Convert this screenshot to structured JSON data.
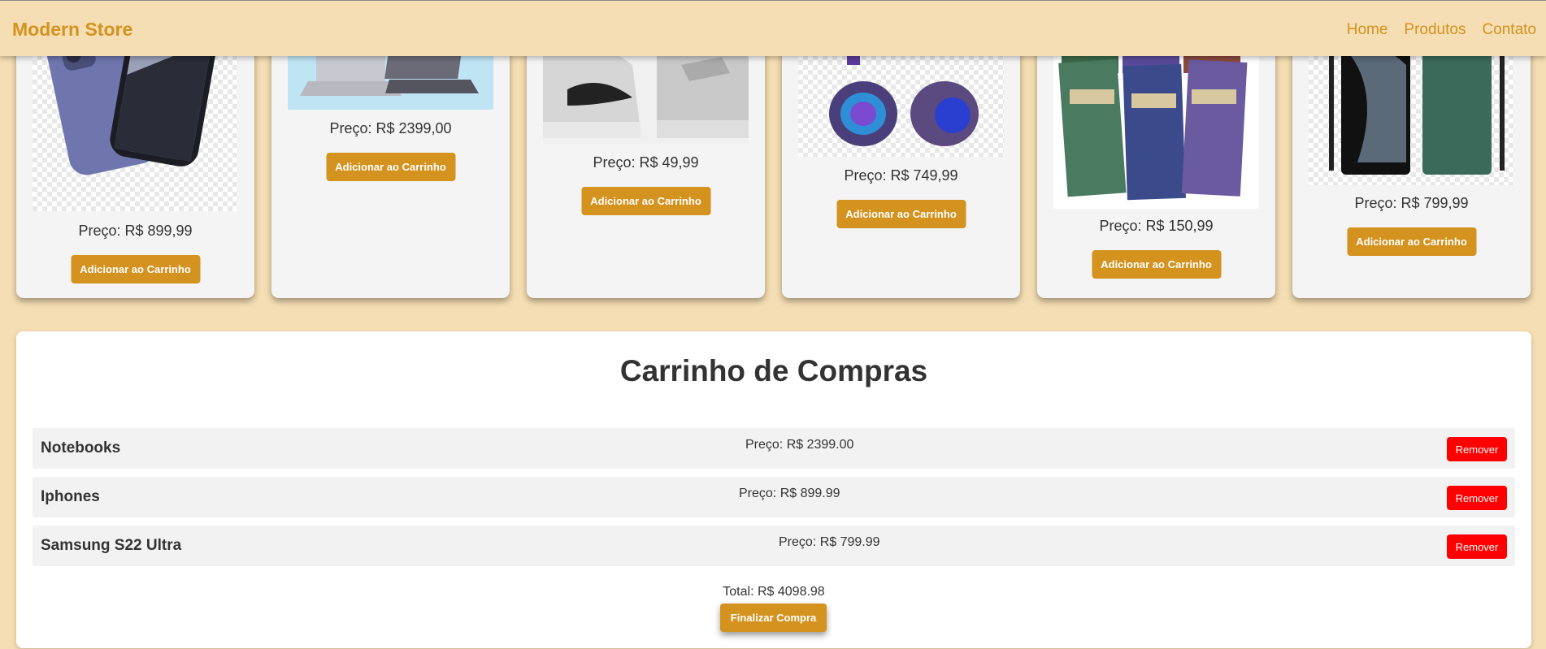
{
  "header": {
    "brand": "Modern Store",
    "nav": [
      "Home",
      "Produtos",
      "Contato"
    ]
  },
  "products": [
    {
      "image": "iphone-image",
      "price": "Preço: R$ 899,99",
      "button": "Adicionar ao Carrinho"
    },
    {
      "image": "notebook-image",
      "price": "Preço: R$ 2399,00",
      "button": "Adicionar ao Carrinho"
    },
    {
      "image": "sneakers-image",
      "price": "Preço: R$ 49,99",
      "button": "Adicionar ao Carrinho"
    },
    {
      "image": "headphones-image",
      "price": "Preço: R$ 749,99",
      "button": "Adicionar ao Carrinho"
    },
    {
      "image": "books-image",
      "price": "Preço: R$ 150,99",
      "button": "Adicionar ao Carrinho"
    },
    {
      "image": "samsung-image",
      "price": "Preço: R$ 799,99",
      "button": "Adicionar ao Carrinho"
    }
  ],
  "cart": {
    "title": "Carrinho de Compras",
    "items": [
      {
        "name": "Notebooks",
        "price": "Preço: R$ 2399.00",
        "remove": "Remover"
      },
      {
        "name": "Iphones",
        "price": "Preço: R$ 899.99",
        "remove": "Remover"
      },
      {
        "name": "Samsung S22 Ultra",
        "price": "Preço: R$ 799.99",
        "remove": "Remover"
      }
    ],
    "total": "Total: R$ 4098.98",
    "checkout": "Finalizar Compra"
  },
  "colors": {
    "background": "#f5deb3",
    "accent": "#d4921f",
    "remove": "#ff0000"
  }
}
